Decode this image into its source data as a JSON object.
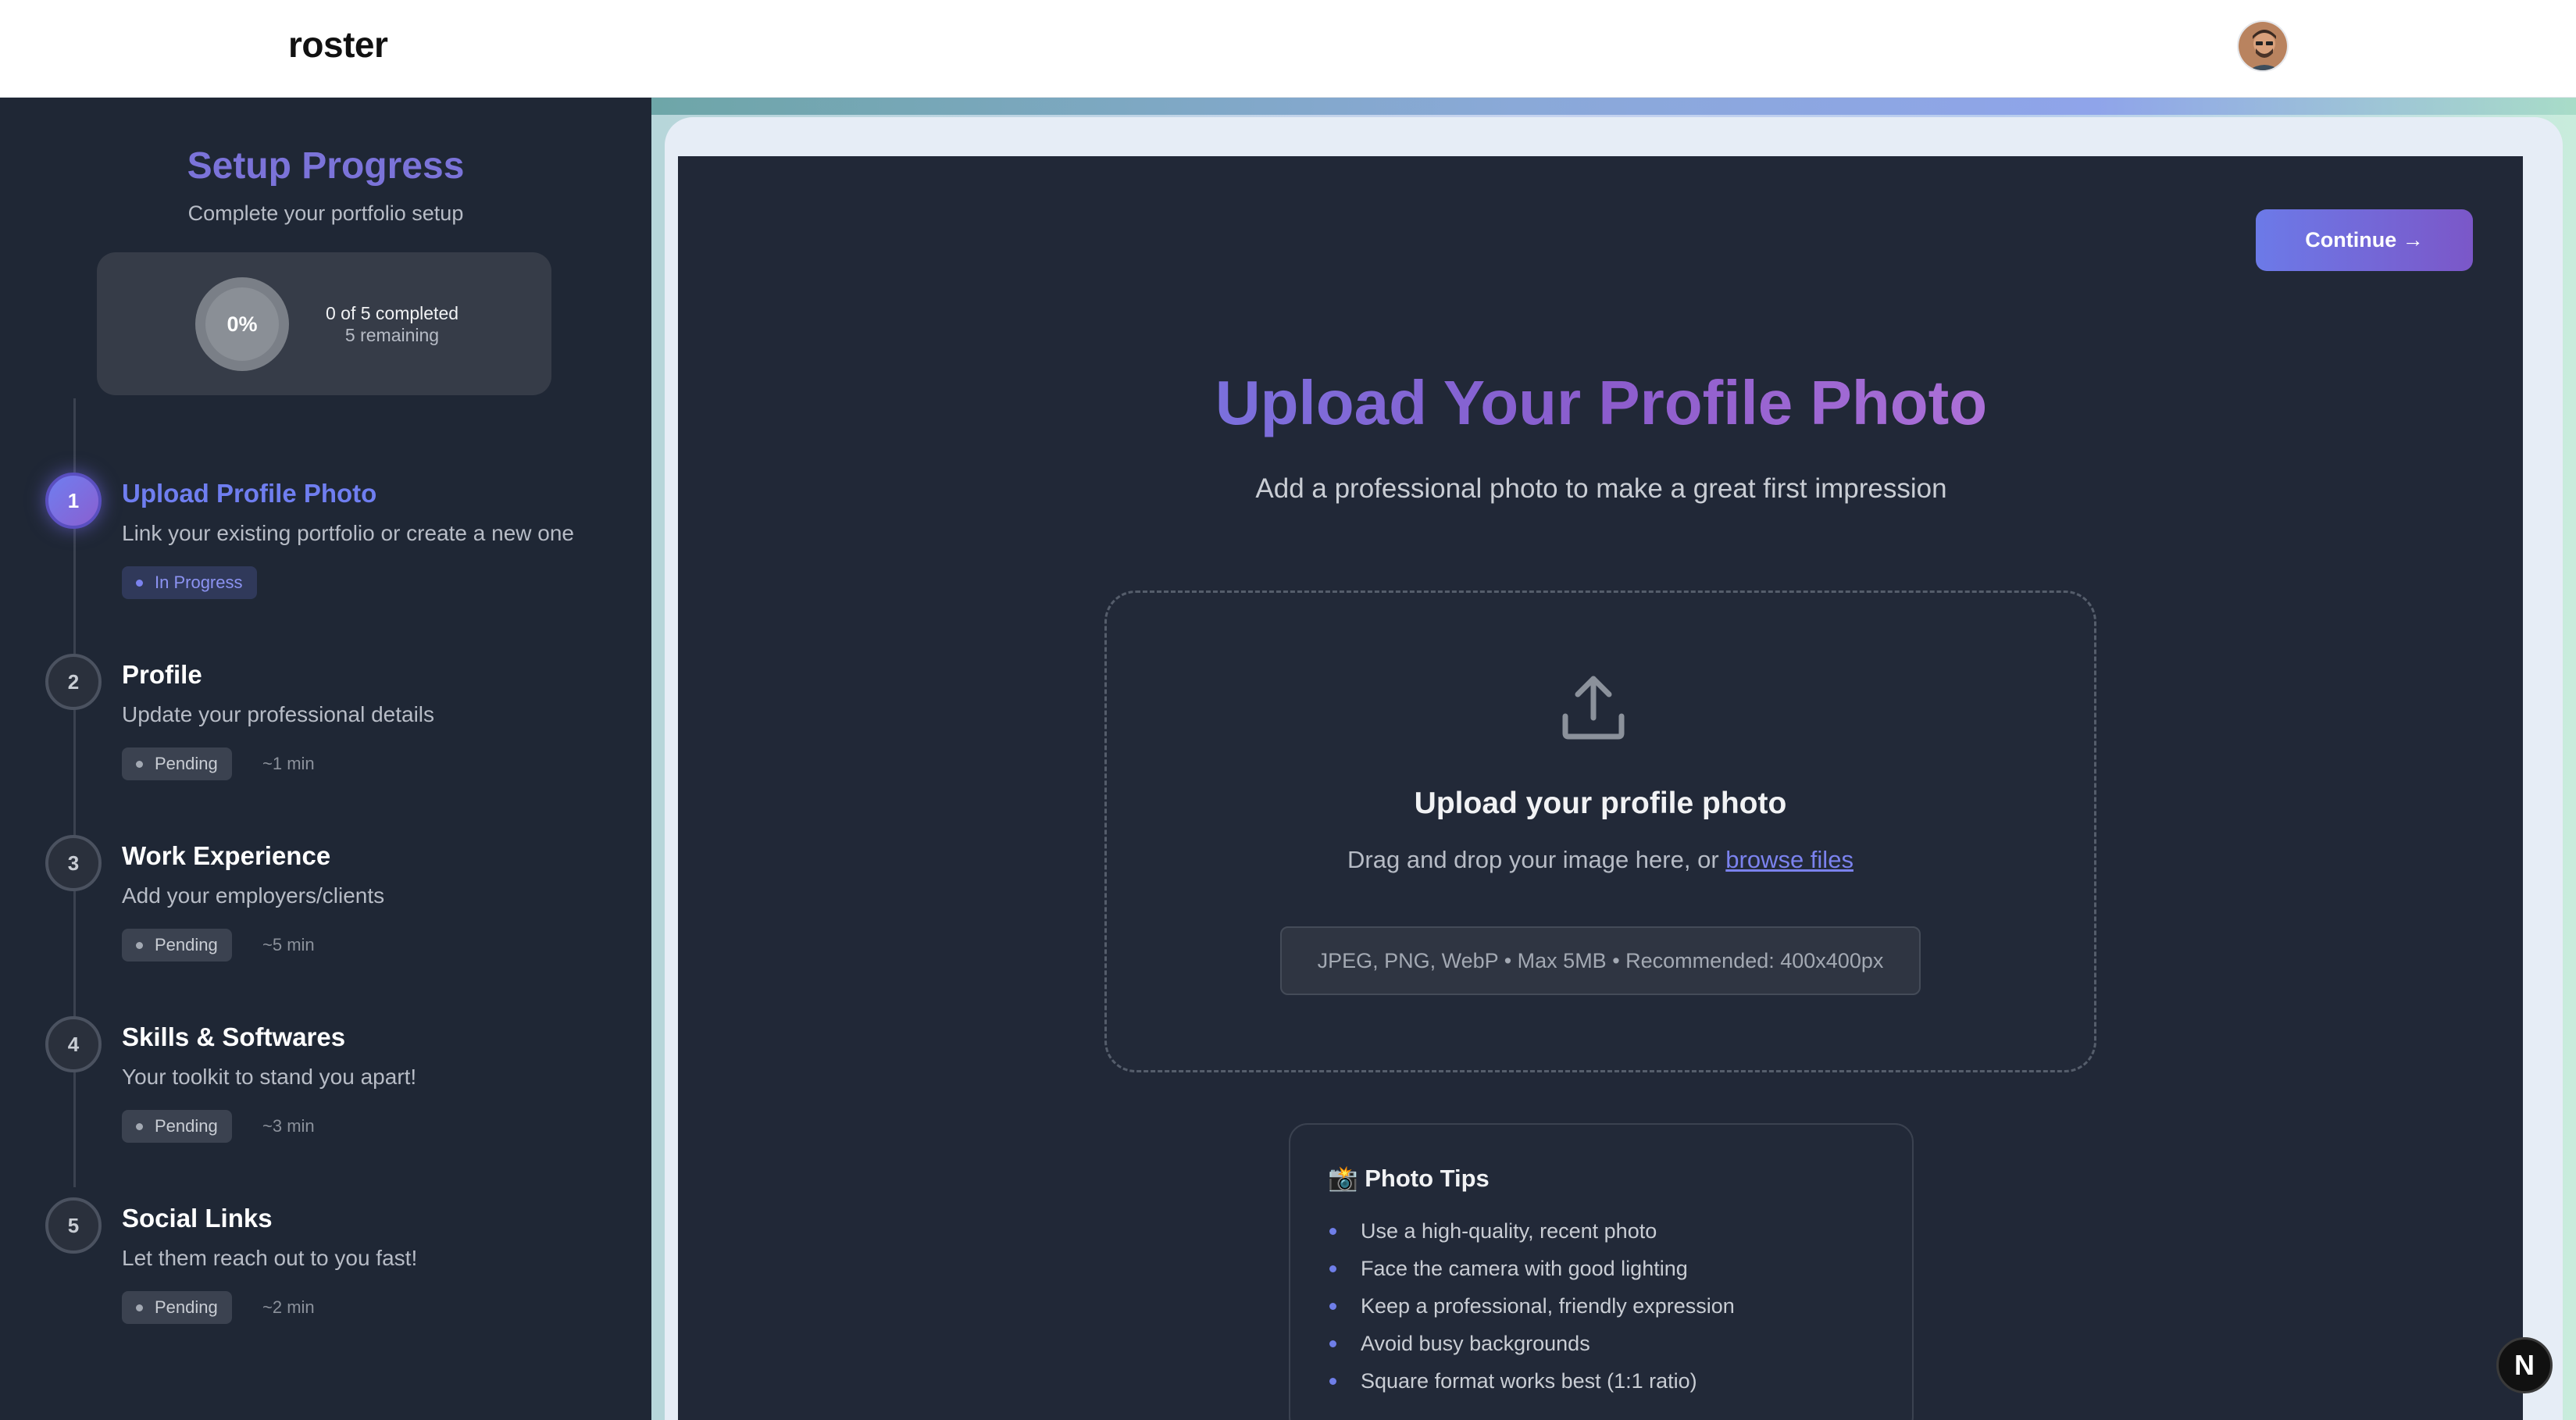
{
  "header": {
    "brand": "roster"
  },
  "sidebar": {
    "title": "Setup Progress",
    "subtitle": "Complete your portfolio setup",
    "progress": {
      "percent_label": "0%",
      "percent": 0,
      "completed_text": "0 of 5 completed",
      "remaining_text": "5 remaining"
    },
    "steps": [
      {
        "number": "1",
        "title": "Upload Profile Photo",
        "description": "Link your existing portfolio or create a new one",
        "status": "In Progress",
        "eta": ""
      },
      {
        "number": "2",
        "title": "Profile",
        "description": "Update your professional details",
        "status": "Pending",
        "eta": "~1 min"
      },
      {
        "number": "3",
        "title": "Work Experience",
        "description": "Add your employers/clients",
        "status": "Pending",
        "eta": "~5 min"
      },
      {
        "number": "4",
        "title": "Skills & Softwares",
        "description": "Your toolkit to stand you apart!",
        "status": "Pending",
        "eta": "~3 min"
      },
      {
        "number": "5",
        "title": "Social Links",
        "description": "Let them reach out to you fast!",
        "status": "Pending",
        "eta": "~2 min"
      }
    ]
  },
  "main": {
    "continue_label": "Continue →",
    "title": "Upload Your Profile Photo",
    "subtitle": "Add a professional photo to make a great first impression",
    "dropzone": {
      "title": "Upload your profile photo",
      "text": "Drag and drop your image here, or ",
      "link": "browse files",
      "formats": "JPEG, PNG, WebP • Max 5MB • Recommended: 400x400px"
    },
    "tips": {
      "title": "📸 Photo Tips",
      "items": [
        "Use a high-quality, recent photo",
        "Face the camera with good lighting",
        "Keep a professional, friendly expression",
        "Avoid busy backgrounds",
        "Square format works best (1:1 ratio)"
      ]
    }
  },
  "overlay": {
    "n_badge": "N"
  },
  "colors": {
    "accent": "#6f7ee8",
    "accent_purple": "#8b5ccc",
    "sidebar_bg": "#1f2735",
    "panel_bg": "#212837"
  }
}
